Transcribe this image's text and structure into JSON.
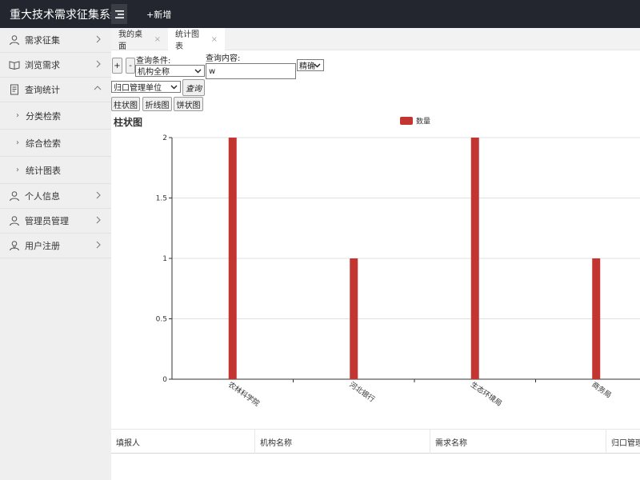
{
  "app": {
    "title": "重大技术需求征集系统",
    "add_new": "+新增"
  },
  "sidebar": {
    "items": [
      {
        "label": "需求征集",
        "icon": "user-icon"
      },
      {
        "label": "浏览需求",
        "icon": "book-icon"
      },
      {
        "label": "查询统计",
        "icon": "document-icon",
        "expanded": true
      },
      {
        "label": "个人信息",
        "icon": "user-icon"
      },
      {
        "label": "管理员管理",
        "icon": "user-icon"
      },
      {
        "label": "用户注册",
        "icon": "user-add-icon"
      }
    ],
    "sub_items": [
      "分类检索",
      "综合检索",
      "统计图表"
    ]
  },
  "tabs": [
    {
      "label": "我的桌面",
      "active": false
    },
    {
      "label": "统计图表",
      "active": true
    }
  ],
  "toolbar": {
    "plus": "+",
    "minus": "-",
    "query_condition_label": "查询条件:",
    "query_condition_value": "机构全称",
    "query_content_label": "查询内容:",
    "query_content_value": "w",
    "match_value": "精确",
    "unit_value": "归口管理单位",
    "query_button": "查询",
    "bar_button": "柱状图",
    "line_button": "折线图",
    "pie_button": "饼状图"
  },
  "chart_data": {
    "type": "bar",
    "title": "柱状图",
    "categories": [
      "农林科学院",
      "河北银行",
      "生态环境局",
      "商务局"
    ],
    "series": [
      {
        "name": "数量",
        "values": [
          2,
          1,
          2,
          1
        ],
        "color": "#c23531"
      }
    ],
    "ylim": [
      0,
      2
    ],
    "yticks": [
      "0",
      "0.5",
      "1",
      "1.5",
      "2"
    ],
    "grid": true,
    "legend": "top-center"
  },
  "table": {
    "columns": [
      "填报人",
      "机构名称",
      "需求名称",
      "归口管理单位"
    ]
  },
  "colors": {
    "topbar": "#23262e",
    "bar": "#c23531"
  }
}
